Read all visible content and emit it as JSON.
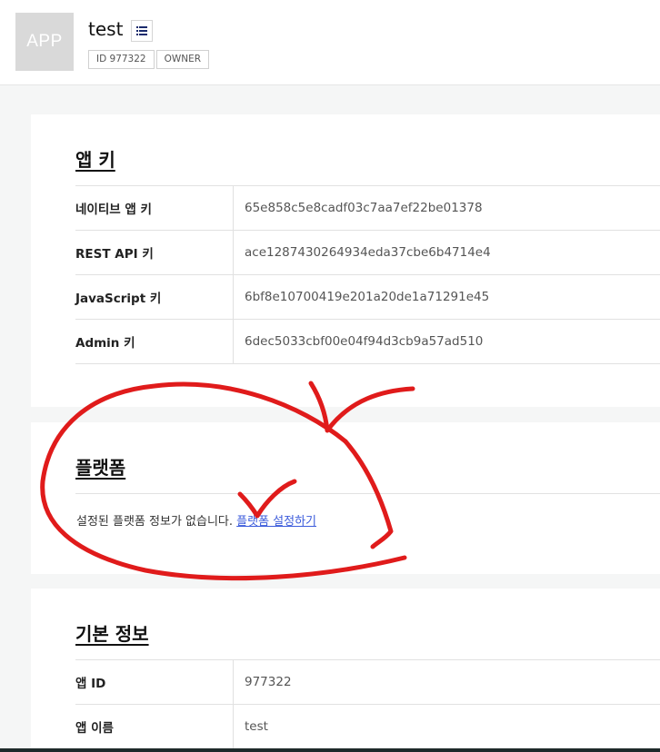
{
  "header": {
    "thumb_label": "APP",
    "app_name": "test",
    "tags": [
      "ID 977322",
      "OWNER"
    ]
  },
  "app_keys": {
    "title": "앱 키",
    "rows": [
      {
        "label": "네이티브 앱 키",
        "value": "65e858c5e8cadf03c7aa7ef22be01378"
      },
      {
        "label": "REST API 키",
        "value": "ace1287430264934eda37cbe6b4714e4"
      },
      {
        "label": "JavaScript 키",
        "value": "6bf8e10700419e201a20de1a71291e45"
      },
      {
        "label": "Admin 키",
        "value": "6dec5033cbf00e04f94d3cb9a57ad510"
      }
    ]
  },
  "platform": {
    "title": "플랫폼",
    "empty_message": "설정된 플랫폼 정보가 없습니다.",
    "setup_link": "플랫폼 설정하기"
  },
  "basic_info": {
    "title": "기본 정보",
    "rows": [
      {
        "label": "앱 ID",
        "value": "977322"
      },
      {
        "label": "앱 이름",
        "value": "test"
      }
    ]
  },
  "colors": {
    "annotation": "#e01b1b",
    "link": "#3b5bdb"
  }
}
